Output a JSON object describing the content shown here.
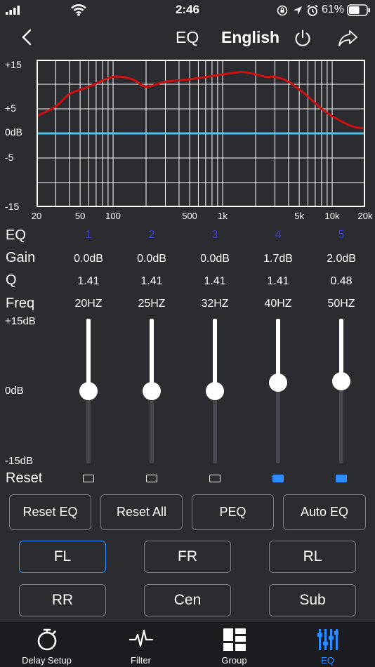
{
  "status": {
    "time": "2:46",
    "battery": "61%",
    "battery_level": 0.61
  },
  "header": {
    "title": "EQ",
    "language": "English"
  },
  "graph": {
    "y_labels": [
      "+15",
      "+5",
      "0dB",
      "-5",
      "-15"
    ],
    "x_labels": [
      "20",
      "50",
      "100",
      "500",
      "1k",
      "5k",
      "10k",
      "20k"
    ],
    "colors": {
      "curve": "#d01010",
      "zero_line": "#4ec0ea",
      "grid": "#ffffff"
    }
  },
  "chart_data": {
    "type": "line",
    "xscale": "log",
    "xlim": [
      20,
      20000
    ],
    "ylim": [
      -15,
      15
    ],
    "x_ticks": [
      "20",
      "50",
      "100",
      "500",
      "1k",
      "5k",
      "10k",
      "20k"
    ],
    "y_ticks": [
      "+15",
      "+5",
      "0dB",
      "-5",
      "-15"
    ],
    "series": [
      {
        "x": [
          20,
          30,
          40,
          60,
          100,
          150,
          200,
          300,
          500,
          700,
          1000,
          1500,
          2000,
          2500,
          3000,
          4000,
          6000,
          8000,
          10000,
          15000,
          20000
        ],
        "y": [
          3.5,
          5.5,
          8,
          9.5,
          11.5,
          11,
          9.5,
          10.5,
          11,
          11.5,
          12,
          12.5,
          12,
          11.5,
          11.5,
          10.5,
          7.5,
          5,
          3.5,
          1.5,
          1
        ]
      },
      {
        "x": [
          20,
          20000
        ],
        "y": [
          0,
          0
        ]
      }
    ]
  },
  "table": {
    "labels": {
      "eq": "EQ",
      "gain": "Gain",
      "q": "Q",
      "freq": "Freq",
      "reset": "Reset"
    },
    "bands": [
      {
        "num": "1",
        "gain": "0.0dB",
        "q": "1.41",
        "freq": "20HZ",
        "gain_value": 0.0,
        "reset_on": false
      },
      {
        "num": "2",
        "gain": "0.0dB",
        "q": "1.41",
        "freq": "25HZ",
        "gain_value": 0.0,
        "reset_on": false
      },
      {
        "num": "3",
        "gain": "0.0dB",
        "q": "1.41",
        "freq": "32HZ",
        "gain_value": 0.0,
        "reset_on": false
      },
      {
        "num": "4",
        "gain": "1.7dB",
        "q": "1.41",
        "freq": "40HZ",
        "gain_value": 1.7,
        "reset_on": true
      },
      {
        "num": "5",
        "gain": "2.0dB",
        "q": "0.48",
        "freq": "50HZ",
        "gain_value": 2.0,
        "reset_on": true
      }
    ]
  },
  "slider_labels": {
    "top": "+15dB",
    "mid": "0dB",
    "bottom": "-15dB"
  },
  "actions": {
    "reset_eq": "Reset EQ",
    "reset_all": "Reset All",
    "peq": "PEQ",
    "auto_eq": "Auto EQ"
  },
  "channels": {
    "fl": "FL",
    "fr": "FR",
    "rl": "RL",
    "rr": "RR",
    "cen": "Cen",
    "sub": "Sub",
    "selected": "FL"
  },
  "tabs": {
    "delay": "Delay Setup",
    "filter": "Filter",
    "group": "Group",
    "eq": "EQ",
    "active": "EQ"
  },
  "colors": {
    "background": "#2b2c30",
    "accent": "#2d8cff",
    "tabbar": "#1c1d20"
  }
}
